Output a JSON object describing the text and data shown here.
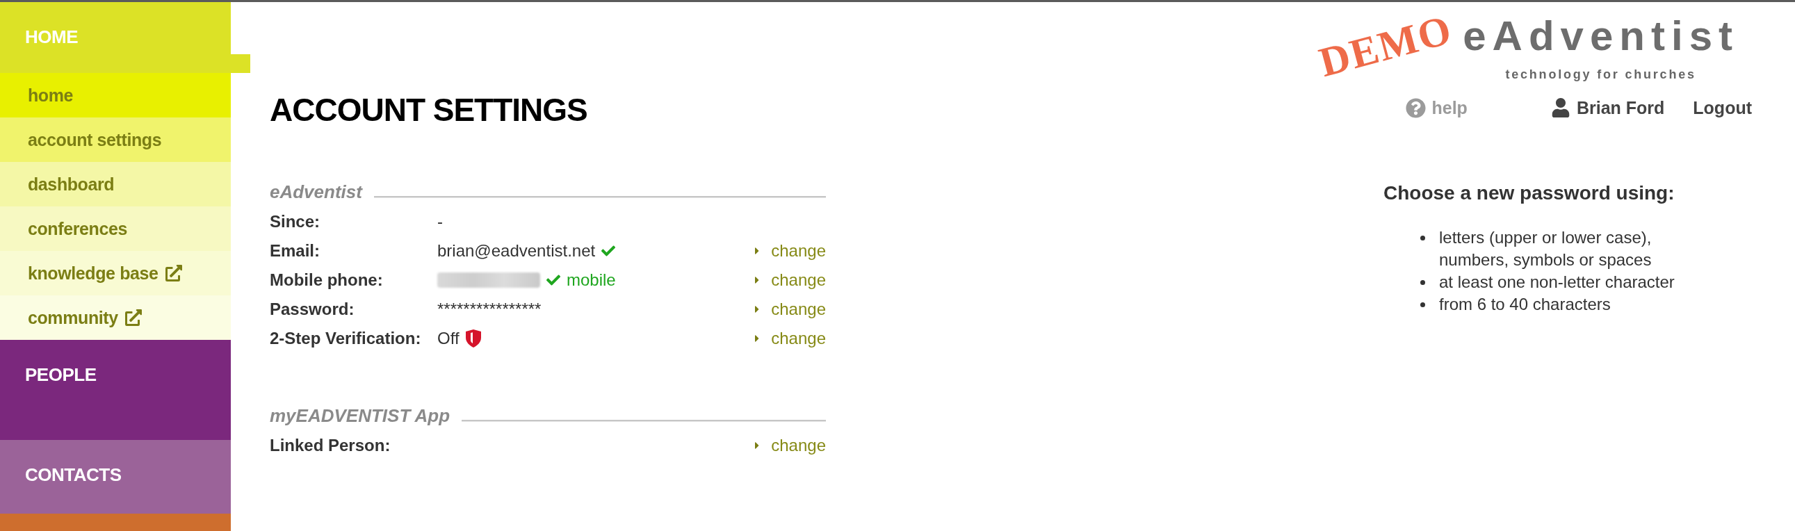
{
  "sidebar": {
    "sections": [
      {
        "label": "HOME",
        "color": "#dce226",
        "selected": true,
        "children": [
          {
            "label": "home",
            "selected": false,
            "external": false
          },
          {
            "label": "account settings",
            "selected": false,
            "external": false
          },
          {
            "label": "dashboard",
            "selected": false,
            "external": false
          },
          {
            "label": "conferences",
            "selected": false,
            "external": false
          },
          {
            "label": "knowledge base",
            "selected": false,
            "external": true
          },
          {
            "label": "community",
            "selected": false,
            "external": true
          }
        ]
      },
      {
        "label": "PEOPLE",
        "color": "#7b287d",
        "selected": false
      },
      {
        "label": "CONTACTS",
        "color": "#9b6399",
        "selected": false
      },
      {
        "color": "#ce6e2e",
        "selected": false
      }
    ]
  },
  "header": {
    "logo": {
      "stamp": "DEMO",
      "wordmark": "eAdventist",
      "tagline": "technology for churches"
    },
    "help": "help",
    "user": "Brian Ford",
    "logout": "Logout"
  },
  "page_title": "ACCOUNT SETTINGS",
  "sections": [
    {
      "title": "eAdventist",
      "rows": [
        {
          "label": "Since:",
          "kind": "plain",
          "value": "-"
        },
        {
          "label": "Email:",
          "kind": "verified",
          "value": "brian@eadventist.net",
          "verified": true,
          "action": "change"
        },
        {
          "label": "Mobile phone:",
          "kind": "redacted",
          "verified": true,
          "note": "mobile",
          "action": "change"
        },
        {
          "label": "Password:",
          "kind": "plain",
          "value": "****************",
          "action": "change"
        },
        {
          "label": "2-Step Verification:",
          "kind": "security",
          "value": "Off",
          "enabled": false,
          "action": "change"
        }
      ]
    },
    {
      "title": "myEADVENTIST App",
      "rows": [
        {
          "label": "Linked Person:",
          "kind": "plain",
          "action": "change"
        }
      ]
    }
  ],
  "password_help": {
    "title": "Choose a new password using:",
    "rules": [
      "letters (upper or lower case), numbers, symbols or spaces",
      "at least one non-letter character",
      "from 6 to 40 characters"
    ]
  }
}
